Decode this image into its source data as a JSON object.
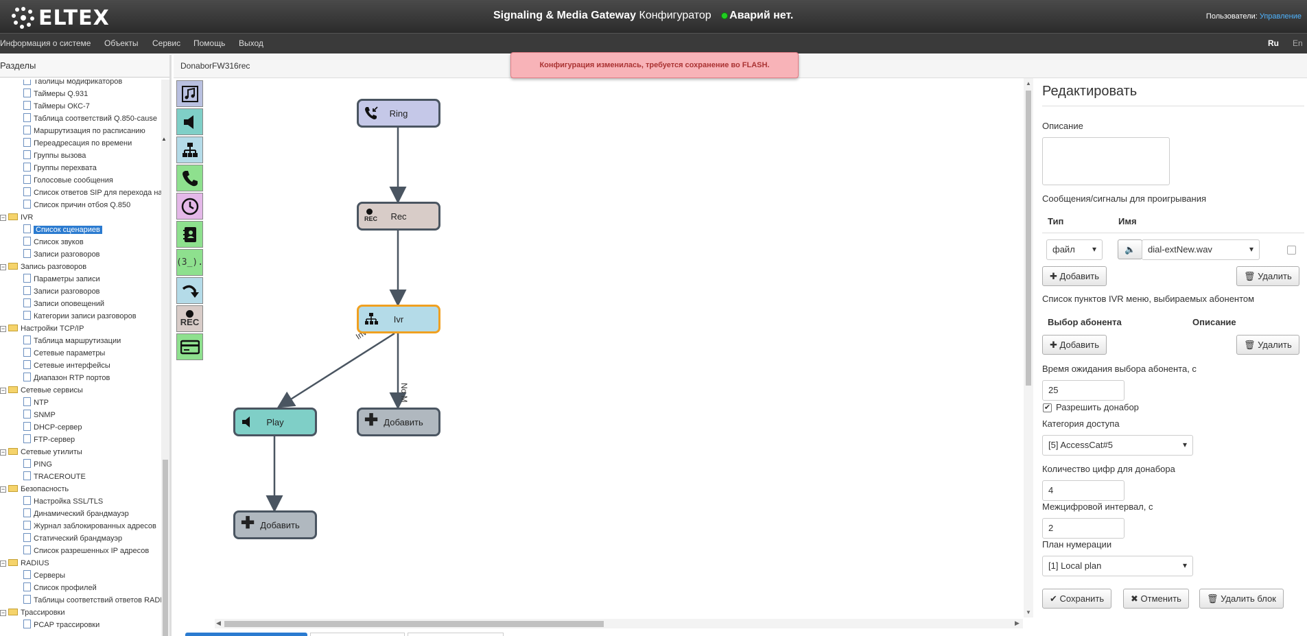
{
  "header": {
    "logo_text": "ELTEX",
    "title_bold": "Signaling & Media Gateway",
    "title_rest": "Конфигуратор",
    "alarm_text": "Аварий нет.",
    "users_label": "Пользователи:",
    "users_link": "Управление"
  },
  "menu": {
    "items": [
      "Информация о системе",
      "Объекты",
      "Сервис",
      "Помощь",
      "Выход"
    ],
    "lang_ru": "Ru",
    "lang_en": "En"
  },
  "sidebar": {
    "title": "Разделы",
    "items": [
      {
        "label": "Таблицы модификаторов"
      },
      {
        "label": "Таймеры Q.931"
      },
      {
        "label": "Таймеры ОКС-7"
      },
      {
        "label": "Таблица соответствий Q.850-cause"
      },
      {
        "label": "Маршрутизация по расписанию"
      },
      {
        "label": "Переадресация по времени"
      },
      {
        "label": "Группы вызова"
      },
      {
        "label": "Группы перехвата"
      },
      {
        "label": "Голосовые сообщения"
      },
      {
        "label": "Список ответов SIP для перехода на"
      },
      {
        "label": "Список причин отбоя Q.850"
      },
      {
        "label": "IVR"
      },
      {
        "label": "Список сценариев"
      },
      {
        "label": "Список звуков"
      },
      {
        "label": "Записи разговоров"
      },
      {
        "label": "Запись разговоров"
      },
      {
        "label": "Параметры записи"
      },
      {
        "label": "Записи разговоров"
      },
      {
        "label": "Записи оповещений"
      },
      {
        "label": "Категории записи разговоров"
      },
      {
        "label": "Настройки TCP/IP"
      },
      {
        "label": "Таблица маршрутизации"
      },
      {
        "label": "Сетевые параметры"
      },
      {
        "label": "Сетевые интерфейсы"
      },
      {
        "label": "Диапазон RTP портов"
      },
      {
        "label": "Сетевые сервисы"
      },
      {
        "label": "NTP"
      },
      {
        "label": "SNMP"
      },
      {
        "label": "DHCP-сервер"
      },
      {
        "label": "FTP-сервер"
      },
      {
        "label": "Сетевые утилиты"
      },
      {
        "label": "PING"
      },
      {
        "label": "TRACEROUTE"
      },
      {
        "label": "Безопасность"
      },
      {
        "label": "Настройка SSL/TLS"
      },
      {
        "label": "Динамический брандмауэр"
      },
      {
        "label": "Журнал заблокированных адресов"
      },
      {
        "label": "Статический брандмауэр"
      },
      {
        "label": "Список разрешенных IP адресов"
      },
      {
        "label": "RADIUS"
      },
      {
        "label": "Серверы"
      },
      {
        "label": "Список профилей"
      },
      {
        "label": "Таблицы соответствий ответов RADI"
      },
      {
        "label": "Трассировки"
      },
      {
        "label": "PCAP трассировки"
      }
    ]
  },
  "doc": {
    "name": "DonaborFW316rec",
    "alert": "Конфигурация изменилась, требуется сохранение во FLASH."
  },
  "palette": {
    "items": [
      "music-icon",
      "speaker-icon",
      "ivr-menu-icon",
      "phone-icon",
      "clock-icon",
      "contacts-icon",
      "digits-icon",
      "redirect-icon",
      "rec-icon",
      "card-icon"
    ],
    "digits_text": "(3_).",
    "rec_text": "REC"
  },
  "flow": {
    "ring": "Ring",
    "rec": "Rec",
    "rec_badge": "REC",
    "ivr": "Ivr",
    "play": "Play",
    "add1": "Добавить",
    "add2": "Добавить",
    "edge_invalid": "Invalid",
    "edge_nomatch": "No M",
    "colors": {
      "ring": "#c5c8e8",
      "rec": "#d8ccc8",
      "ivr": "#b4dbe8",
      "play": "#7fcfc7",
      "add": "#b0b8bf",
      "selected": "#f0a020"
    }
  },
  "panel": {
    "title": "Редактировать",
    "desc_label": "Описание",
    "desc_value": "",
    "msgs_label": "Сообщения/сигналы для проигрывания",
    "col_type": "Тип",
    "col_name": "Имя",
    "type_value": "файл",
    "name_value": "dial-extNew.wav",
    "add1": "Добавить",
    "del1": "Удалить",
    "ivr_list_label": "Список пунктов IVR меню, выбираемых абонентом",
    "col_choice": "Выбор абонента",
    "col_desc": "Описание",
    "add2": "Добавить",
    "del2": "Удалить",
    "wait_label": "Время ожидания выбора абонента, с",
    "wait_value": "25",
    "donabor_label": "Разрешить донабор",
    "donabor_checked": true,
    "access_label": "Категория доступа",
    "access_value": "[5] AccessCat#5",
    "digits_label": "Количество цифр для донабора",
    "digits_value": "4",
    "interval_label": "Межцифровой интервал, с",
    "interval_value": "2",
    "plan_label": "План нумерации",
    "plan_value": "[1] Local plan",
    "save": "Сохранить",
    "cancel": "Отменить",
    "delete_block": "Удалить блок"
  }
}
